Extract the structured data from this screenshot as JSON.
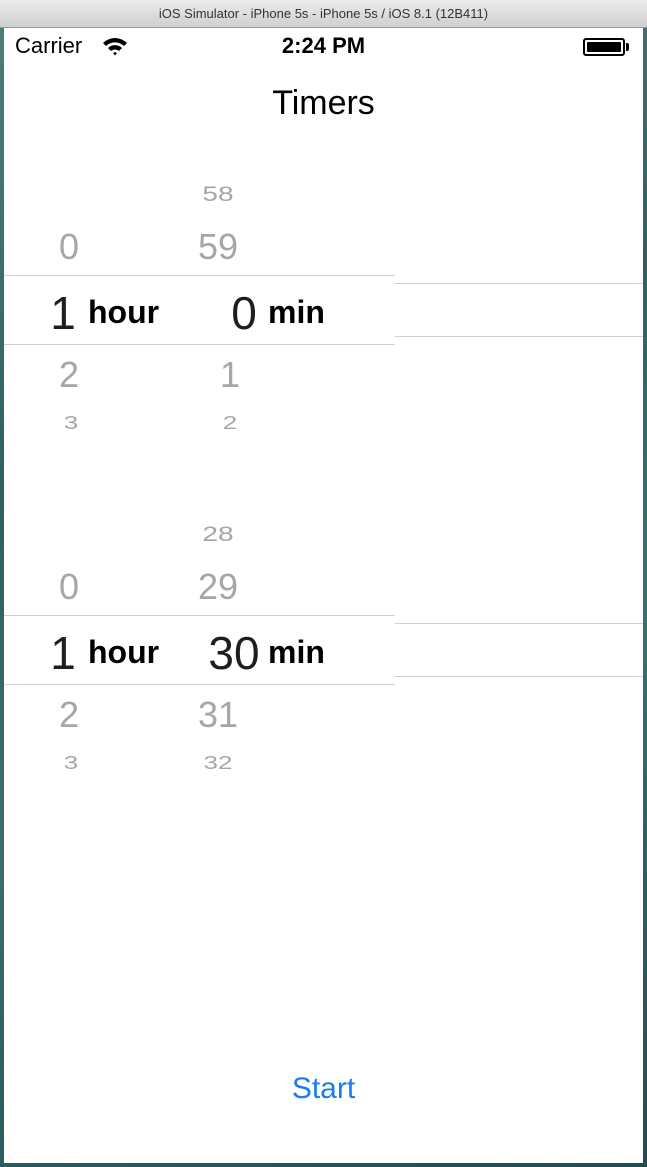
{
  "simulator": {
    "title": "iOS Simulator - iPhone 5s - iPhone 5s / iOS 8.1 (12B411)"
  },
  "status_bar": {
    "carrier": "Carrier",
    "time": "2:24 PM"
  },
  "nav": {
    "title": "Timers"
  },
  "pickers": [
    {
      "hours": [
        "0",
        "1",
        "2",
        "3"
      ],
      "hour_unit": "hour",
      "minutes": [
        "58",
        "59",
        "0",
        "1",
        "2"
      ],
      "min_unit": "min"
    },
    {
      "hours": [
        "0",
        "1",
        "2",
        "3"
      ],
      "hour_unit": "hour",
      "minutes": [
        "28",
        "29",
        "30",
        "31",
        "32"
      ],
      "min_unit": "min"
    }
  ],
  "start_button": {
    "label": "Start"
  },
  "colors": {
    "accent": "#1a7cf1",
    "selected_text": "#1e1e1e",
    "unselected_text": "#a6a6a6",
    "divider": "#cfcfcf"
  }
}
